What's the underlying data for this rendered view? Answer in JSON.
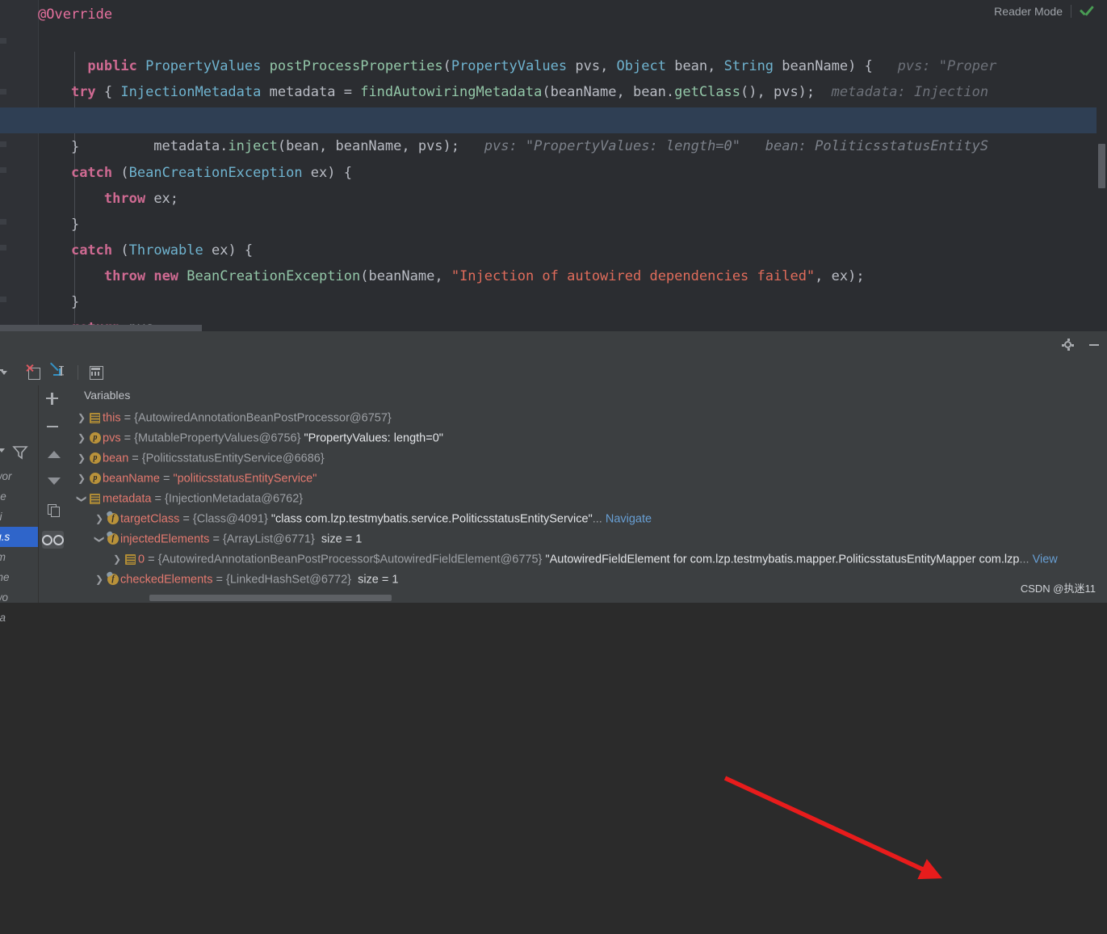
{
  "editor": {
    "reader_mode": {
      "label": "Reader Mode",
      "check_icon": "check-icon"
    },
    "lines": [
      {
        "id": "l1",
        "text": "@Override"
      },
      {
        "id": "l2",
        "text": "public PropertyValues postProcessProperties(PropertyValues pvs, Object bean, String beanName) {"
      },
      {
        "id": "l2hint",
        "text": "pvs: \"Proper"
      },
      {
        "id": "l3",
        "text": "InjectionMetadata metadata = findAutowiringMetadata(beanName, bean.getClass(), pvs);"
      },
      {
        "id": "l3hint",
        "text": "metadata: Injection"
      },
      {
        "id": "l4",
        "text": "try {"
      },
      {
        "id": "l5",
        "text": "metadata.inject(bean, beanName, pvs);"
      },
      {
        "id": "l5hint1",
        "text": "pvs: \"PropertyValues: length=0\""
      },
      {
        "id": "l5hint2",
        "text": "bean: PoliticsstatusEntityS"
      },
      {
        "id": "l6",
        "text": "}"
      },
      {
        "id": "l7",
        "text": "catch (BeanCreationException ex) {"
      },
      {
        "id": "l8",
        "text": "throw ex;"
      },
      {
        "id": "l9",
        "text": "}"
      },
      {
        "id": "l10",
        "text": "catch (Throwable ex) {"
      },
      {
        "id": "l11",
        "text": "throw new BeanCreationException(beanName, \"Injection of autowired dependencies failed\", ex);"
      },
      {
        "id": "l12",
        "text": "}"
      },
      {
        "id": "l13",
        "text": "return pvs;"
      }
    ],
    "tokens": {
      "annotation_override": "@Override",
      "kw_public": "public",
      "kw_try": "try",
      "kw_catch": "catch",
      "kw_throw": "throw",
      "kw_new": "new",
      "kw_return": "return",
      "type_PropertyValues": "PropertyValues",
      "type_Object": "Object",
      "type_String": "String",
      "type_InjectionMetadata": "InjectionMetadata",
      "type_BeanCreationException": "BeanCreationException",
      "type_Throwable": "Throwable",
      "method_postProcessProperties": "postProcessProperties",
      "method_findAutowiringMetadata": "findAutowiringMetadata",
      "method_getClass": "getClass",
      "method_inject": "inject",
      "str_injection_failed": "\"Injection of autowired dependencies failed\""
    }
  },
  "debugger": {
    "header_icons": {
      "settings": "gear-icon",
      "minimize": "minimize-icon",
      "layout": "layout-settings-icon"
    },
    "toolbar_icons": [
      {
        "name": "mute-breakpoints-icon"
      },
      {
        "name": "run-to-cursor-icon"
      },
      {
        "name": "evaluate-expression-icon"
      },
      {
        "name": "show-options-menu-icon"
      }
    ],
    "frames": {
      "filter_icon": "filter-icon",
      "items": [
        {
          "text": "ramewor"
        },
        {
          "text": "dEleme"
        },
        {
          "text": "nnotati"
        },
        {
          "text": "or (org.s",
          "selected": true
        },
        {
          "text": "ingfram"
        },
        {
          "text": "ngframe"
        },
        {
          "text": "ramewo"
        },
        {
          "text": "ork bea"
        }
      ]
    },
    "side_buttons": [
      {
        "name": "add-watch-button",
        "icon": "plus-icon"
      },
      {
        "name": "remove-watch-button",
        "icon": "minus-icon"
      },
      {
        "name": "move-up-button",
        "icon": "triangle-up-icon"
      },
      {
        "name": "move-down-button",
        "icon": "triangle-down-icon"
      },
      {
        "name": "copy-button",
        "icon": "copy-icon"
      },
      {
        "name": "inspect-button",
        "icon": "glasses-icon"
      }
    ],
    "variables_tab": "Variables",
    "variables": [
      {
        "indent": 0,
        "twisty": "collapsed",
        "icon": "list-icon",
        "icon_letter": "",
        "name": "this",
        "eq": " = ",
        "type": "{AutowiredAnnotationBeanPostProcessor@6757}",
        "value": "",
        "size": "",
        "link": ""
      },
      {
        "indent": 0,
        "twisty": "collapsed",
        "icon": "param-icon",
        "icon_letter": "p",
        "name": "pvs",
        "eq": " = ",
        "type": "{MutablePropertyValues@6756}",
        "value": "\"PropertyValues: length=0\"",
        "size": "",
        "link": ""
      },
      {
        "indent": 0,
        "twisty": "collapsed",
        "icon": "param-icon",
        "icon_letter": "p",
        "name": "bean",
        "eq": " = ",
        "type": "{PoliticsstatusEntityService@6686}",
        "value": "",
        "size": "",
        "link": ""
      },
      {
        "indent": 0,
        "twisty": "collapsed",
        "icon": "param-icon",
        "icon_letter": "p",
        "name": "beanName",
        "eq": " = ",
        "type": "",
        "value": "\"politicsstatusEntityService\"",
        "value_style": "red",
        "size": "",
        "link": ""
      },
      {
        "indent": 0,
        "twisty": "expanded",
        "icon": "list-icon",
        "icon_letter": "",
        "name": "metadata",
        "eq": " = ",
        "type": "{InjectionMetadata@6762}",
        "value": "",
        "size": "",
        "link": ""
      },
      {
        "indent": 1,
        "twisty": "collapsed",
        "icon": "field-icon",
        "icon_letter": "f",
        "name": "targetClass",
        "eq": " = ",
        "type": "{Class@4091}",
        "value": "\"class com.lzp.testmybatis.service.PoliticsstatusEntityService\"",
        "ellipsis": "...",
        "link": "Navigate",
        "size": ""
      },
      {
        "indent": 1,
        "twisty": "expanded",
        "icon": "field-icon",
        "icon_letter": "f",
        "name": "injectedElements",
        "eq": " = ",
        "type": "{ArrayList@6771}",
        "value": "",
        "size": "size = 1",
        "link": ""
      },
      {
        "indent": 2,
        "twisty": "collapsed",
        "icon": "list-icon",
        "icon_letter": "",
        "name": "0",
        "eq": " = ",
        "type": "{AutowiredAnnotationBeanPostProcessor$AutowiredFieldElement@6775}",
        "value": "\"AutowiredFieldElement for com.lzp.testmybatis.mapper.PoliticsstatusEntityMapper com.lzp",
        "ellipsis": "...",
        "link": "View",
        "size": ""
      },
      {
        "indent": 1,
        "twisty": "collapsed",
        "icon": "field-icon",
        "icon_letter": "f",
        "name": "checkedElements",
        "eq": " = ",
        "type": "{LinkedHashSet@6772}",
        "value": "",
        "size": "size = 1",
        "link": ""
      }
    ]
  },
  "watermark": "CSDN @执迷11",
  "colors": {
    "editor_bg": "#2b2d31",
    "panel_bg": "#3c3f41",
    "exec_line": "#2f3f54",
    "keyword": "#cf6a92",
    "type": "#6fb3cf",
    "method": "#93c7a8",
    "string": "#e06c5b",
    "var_name": "#e3796f",
    "link": "#689fd4",
    "arrow": "#e81c1c",
    "selection": "#2f65ca"
  }
}
